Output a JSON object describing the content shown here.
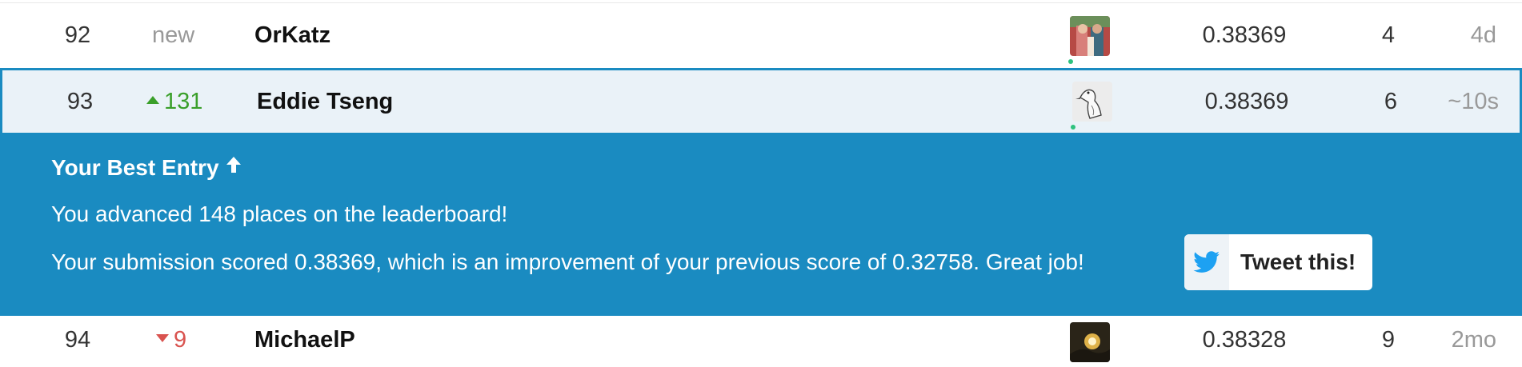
{
  "rows": [
    {
      "rank": "92",
      "change": "new",
      "change_type": "new",
      "name": "OrKatz",
      "score": "0.38369",
      "entries": "4",
      "last": "4d",
      "avatar_icon": "user-photo-avatar"
    },
    {
      "rank": "93",
      "change": "131",
      "change_type": "up",
      "name": "Eddie Tseng",
      "score": "0.38369",
      "entries": "6",
      "last": "~10s",
      "avatar_icon": "goose-sketch-avatar"
    },
    {
      "rank": "94",
      "change": "9",
      "change_type": "down",
      "name": "MichaelP",
      "score": "0.38328",
      "entries": "9",
      "last": "2mo",
      "avatar_icon": "sunset-photo-avatar"
    }
  ],
  "banner": {
    "title": "Your Best Entry",
    "title_icon": "arrow-up-icon",
    "line1": "You advanced 148 places on the leaderboard!",
    "line2": "Your submission scored 0.38369, which is an improvement of your previous score of 0.32758. Great job!",
    "tweet_label": "Tweet this!",
    "tweet_icon": "twitter-bird-icon"
  },
  "colors": {
    "banner_bg": "#1a8bc1",
    "highlight_row_bg": "#eaf2f8",
    "up": "#3a9f2a",
    "down": "#d9534f",
    "online_dot": "#2ec27e"
  }
}
